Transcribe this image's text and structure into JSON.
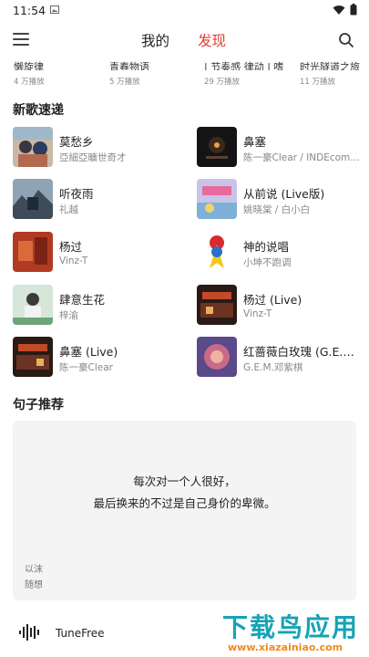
{
  "status_bar": {
    "time": "11:54"
  },
  "header": {
    "tabs": [
      {
        "label": "我的",
        "active": false
      },
      {
        "label": "发现",
        "active": true
      }
    ],
    "accent_color": "#e03c31"
  },
  "playlists": [
    {
      "title": "懒旋律",
      "count": "4 万播放"
    },
    {
      "title": "青春物语",
      "count": "5 万播放"
    },
    {
      "title": "| 节奏感 律动 | 嗜",
      "count": "29 万播放"
    },
    {
      "title": "时光隧道之旅",
      "count": "11 万播放"
    }
  ],
  "new_songs": {
    "title": "新歌速递",
    "items": [
      {
        "title": "莫愁乡",
        "artist": "亞細亞曠世奇才"
      },
      {
        "title": "鼻塞",
        "artist": "陈一豪Clear / INDEcompa..."
      },
      {
        "title": "听夜雨",
        "artist": "礼越"
      },
      {
        "title": "从前说 (Live版)",
        "artist": "姚晓棠 / 白小白"
      },
      {
        "title": "杨过",
        "artist": "Vinz-T"
      },
      {
        "title": "神的说唱",
        "artist": "小坤不跑调"
      },
      {
        "title": "肆意生花",
        "artist": "梓渝"
      },
      {
        "title": "杨过 (Live)",
        "artist": "Vinz-T"
      },
      {
        "title": "鼻塞 (Live)",
        "artist": "陈一豪Clear"
      },
      {
        "title": "红蔷薇白玫瑰 (G.E.M....",
        "artist": "G.E.M.邓紫棋"
      }
    ]
  },
  "quotes": {
    "title": "句子推荐",
    "line1": "每次对一个人很好，",
    "line2": "最后换来的不过是自己身价的卑微。",
    "author": "以沫",
    "source": "随想"
  },
  "player": {
    "name": "TuneFree"
  },
  "watermark": {
    "main": "下载鸟应用",
    "url": "www.xiazainiao.com"
  }
}
